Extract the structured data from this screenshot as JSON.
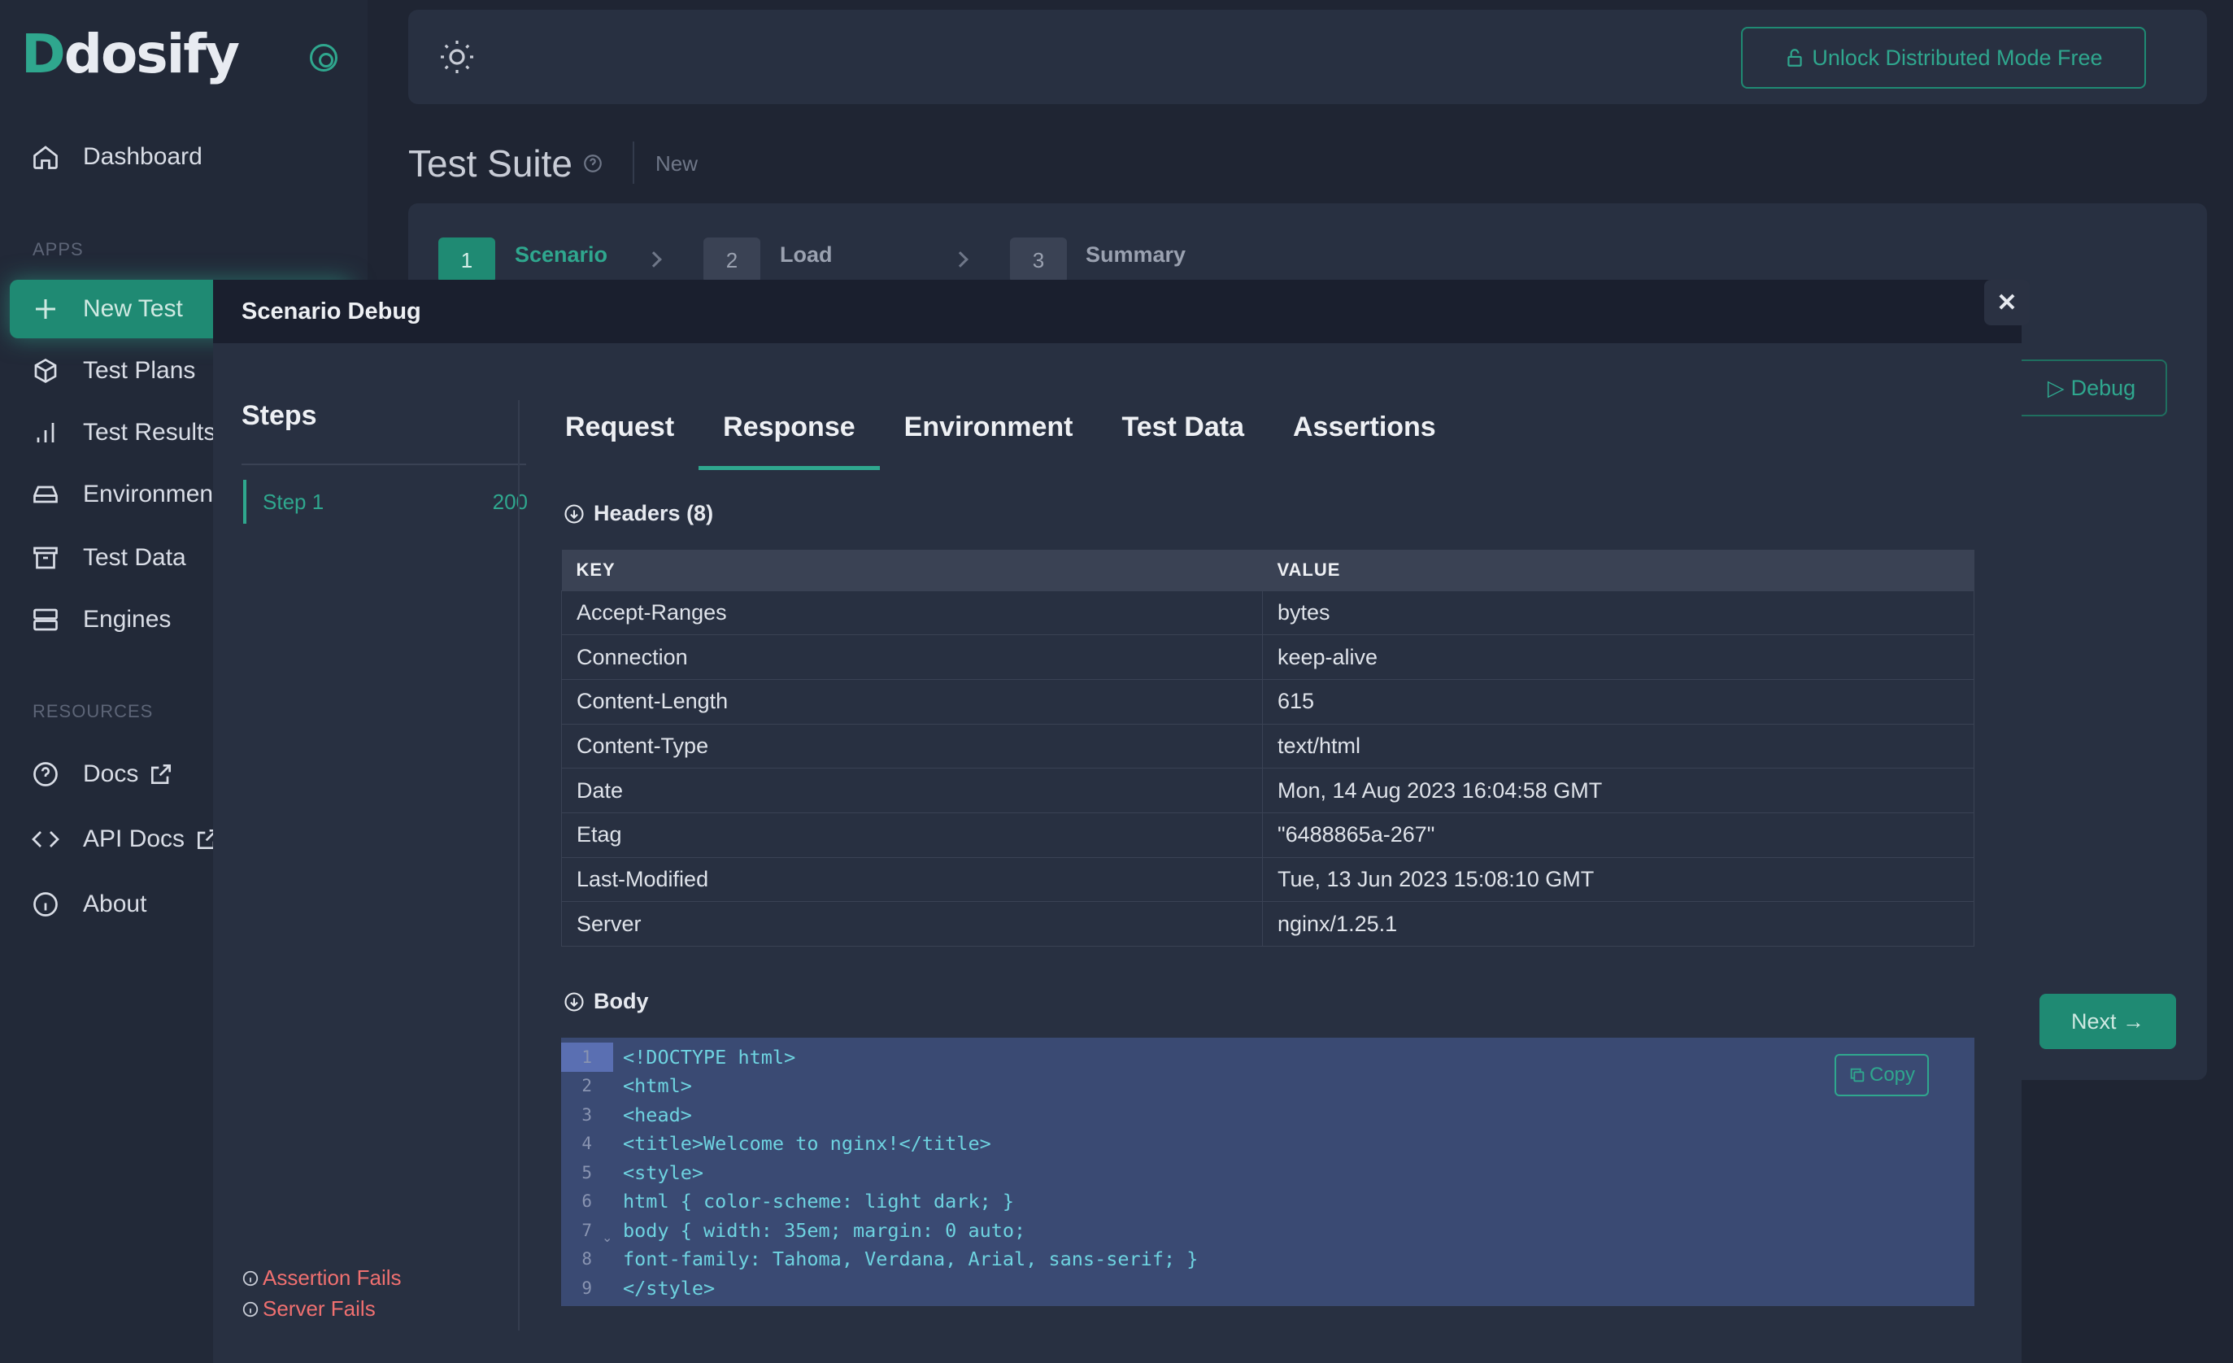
{
  "sidebar": {
    "logo_first": "D",
    "logo_rest": "dosify",
    "nav": [
      {
        "label": "Dashboard"
      },
      {
        "label": "New Test"
      },
      {
        "label": "Test Plans"
      },
      {
        "label": "Test Results"
      },
      {
        "label": "Environments"
      },
      {
        "label": "Test Data"
      },
      {
        "label": "Engines"
      },
      {
        "label": "Docs"
      },
      {
        "label": "API Docs"
      },
      {
        "label": "About"
      }
    ],
    "section_apps": "APPS",
    "section_resources": "RESOURCES"
  },
  "topbar": {
    "unlock_label": "Unlock Distributed Mode Free"
  },
  "page": {
    "title": "Test Suite",
    "mode": "New"
  },
  "wizard": {
    "steps": [
      {
        "number": "1",
        "label": "Scenario"
      },
      {
        "number": "2",
        "label": "Load"
      },
      {
        "number": "3",
        "label": "Summary"
      }
    ],
    "debug_label": "Debug",
    "next_label": "Next →"
  },
  "modal": {
    "title": "Scenario Debug",
    "close_label": "✕",
    "steps_title": "Steps",
    "step_items": [
      {
        "label": "Step 1",
        "status": "200"
      }
    ],
    "legend": {
      "assertion_fails": "Assertion Fails",
      "server_fails": "Server Fails"
    },
    "tabs": [
      {
        "label": "Request"
      },
      {
        "label": "Response"
      },
      {
        "label": "Environment"
      },
      {
        "label": "Test Data"
      },
      {
        "label": "Assertions"
      }
    ],
    "active_tab": "Response",
    "headers_toggle": "Headers (8)",
    "headers_columns": [
      "KEY",
      "VALUE"
    ],
    "headers": [
      {
        "key": "Accept-Ranges",
        "value": "bytes"
      },
      {
        "key": "Connection",
        "value": "keep-alive"
      },
      {
        "key": "Content-Length",
        "value": "615"
      },
      {
        "key": "Content-Type",
        "value": "text/html"
      },
      {
        "key": "Date",
        "value": "Mon, 14 Aug 2023 16:04:58 GMT"
      },
      {
        "key": "Etag",
        "value": "\"6488865a-267\""
      },
      {
        "key": "Last-Modified",
        "value": "Tue, 13 Jun 2023 15:08:10 GMT"
      },
      {
        "key": "Server",
        "value": "nginx/1.25.1"
      }
    ],
    "body_toggle": "Body",
    "copy_label": "Copy",
    "code_lines": [
      {
        "n": "1",
        "text": "<!DOCTYPE html>"
      },
      {
        "n": "2",
        "text": "<html>"
      },
      {
        "n": "3",
        "text": "<head>"
      },
      {
        "n": "4",
        "text": "<title>Welcome to nginx!</title>"
      },
      {
        "n": "5",
        "text": "<style>"
      },
      {
        "n": "6",
        "text": "html { color-scheme: light dark; }"
      },
      {
        "n": "7",
        "text": "body { width: 35em; margin: 0 auto;"
      },
      {
        "n": "8",
        "text": "font-family: Tahoma, Verdana, Arial, sans-serif; }"
      },
      {
        "n": "9",
        "text": "</style>"
      }
    ]
  },
  "colors": {
    "accent": "#2fa78e",
    "accent_dark": "#1f8a73",
    "fail": "#f07070",
    "code_bg": "#3a4a73"
  }
}
